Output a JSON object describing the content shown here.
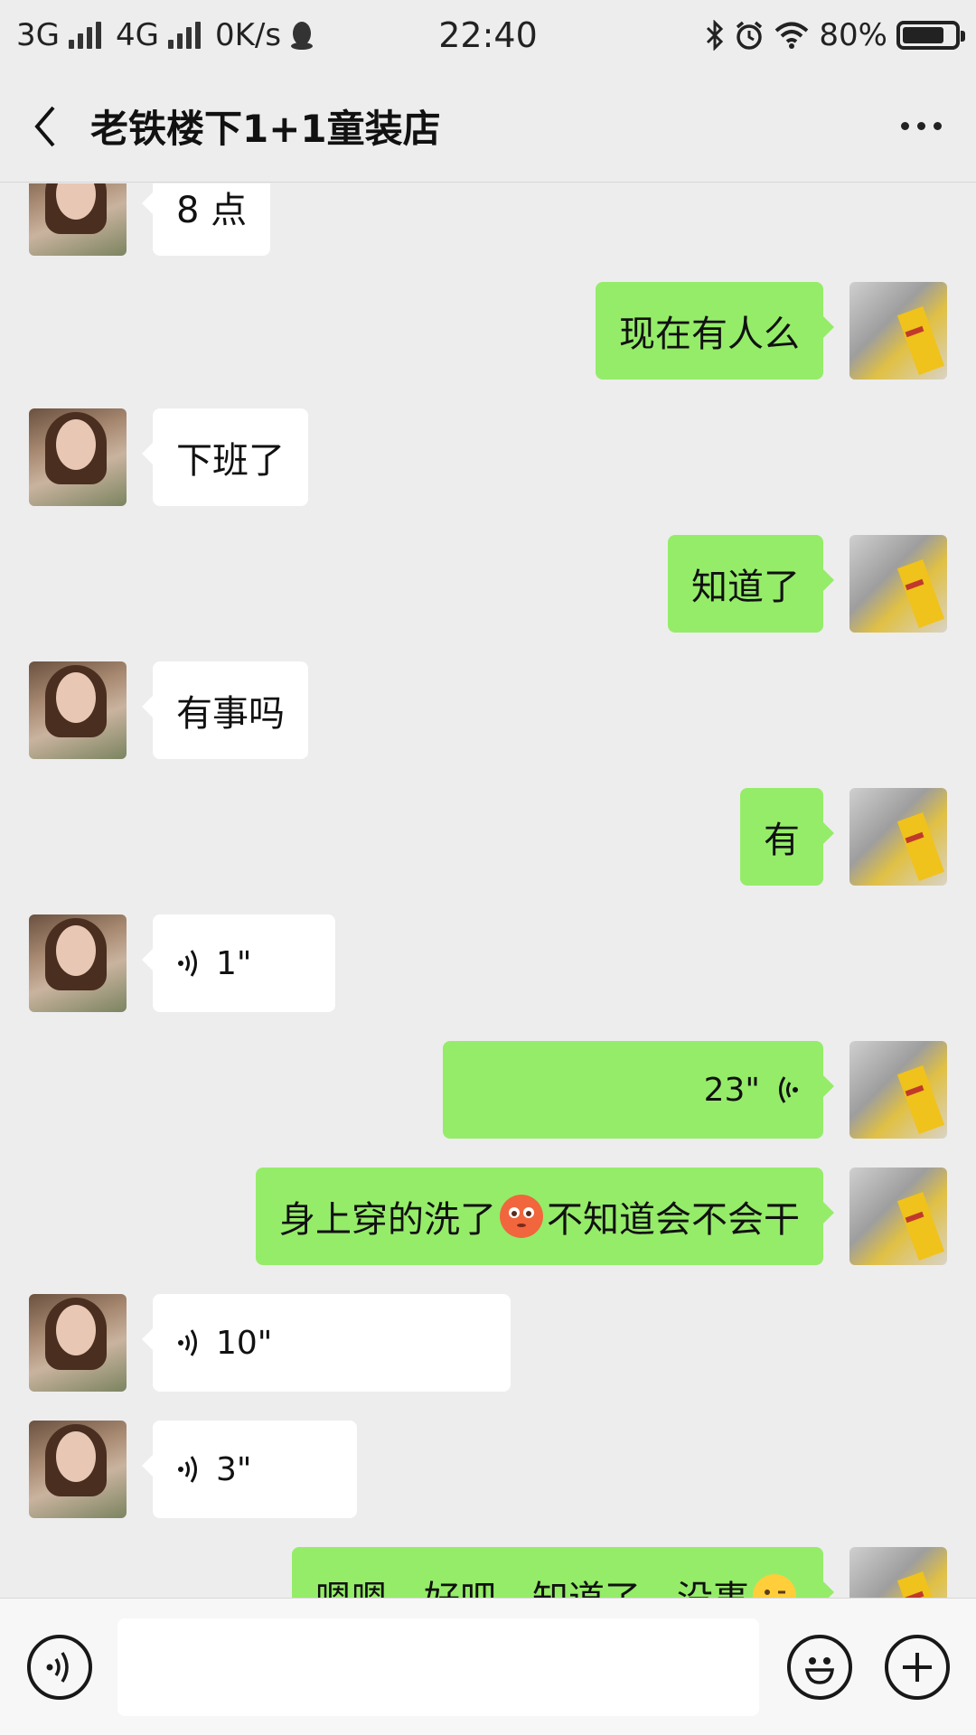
{
  "status_bar": {
    "network1": "3G",
    "network2": "4G",
    "speed": "0K/s",
    "time": "22:40",
    "battery": "80%",
    "battery_level": 0.8
  },
  "header": {
    "title": "老铁楼下1+1童装店"
  },
  "messages": [
    {
      "from": "other",
      "type": "text",
      "text": "8 点"
    },
    {
      "from": "me",
      "type": "text",
      "text": "现在有人么"
    },
    {
      "from": "other",
      "type": "text",
      "text": "下班了"
    },
    {
      "from": "me",
      "type": "text",
      "text": "知道了"
    },
    {
      "from": "other",
      "type": "text",
      "text": "有事吗"
    },
    {
      "from": "me",
      "type": "text",
      "text": "有"
    },
    {
      "from": "other",
      "type": "voice",
      "duration": "1\""
    },
    {
      "from": "me",
      "type": "voice",
      "duration": "23\""
    },
    {
      "from": "me",
      "type": "text",
      "text_before": "身上穿的洗了",
      "emoji": "flushed-emoji",
      "text_after": "不知道会不会干"
    },
    {
      "from": "other",
      "type": "voice",
      "duration": "10\""
    },
    {
      "from": "other",
      "type": "voice",
      "duration": "3\""
    },
    {
      "from": "me",
      "type": "text",
      "text": "嗯嗯，好吧，知道了，没事",
      "emoji": "wink-emoji"
    }
  ],
  "input": {
    "placeholder": ""
  },
  "colors": {
    "background": "#ededed",
    "bubble_me": "#95ec69",
    "bubble_other": "#ffffff"
  }
}
